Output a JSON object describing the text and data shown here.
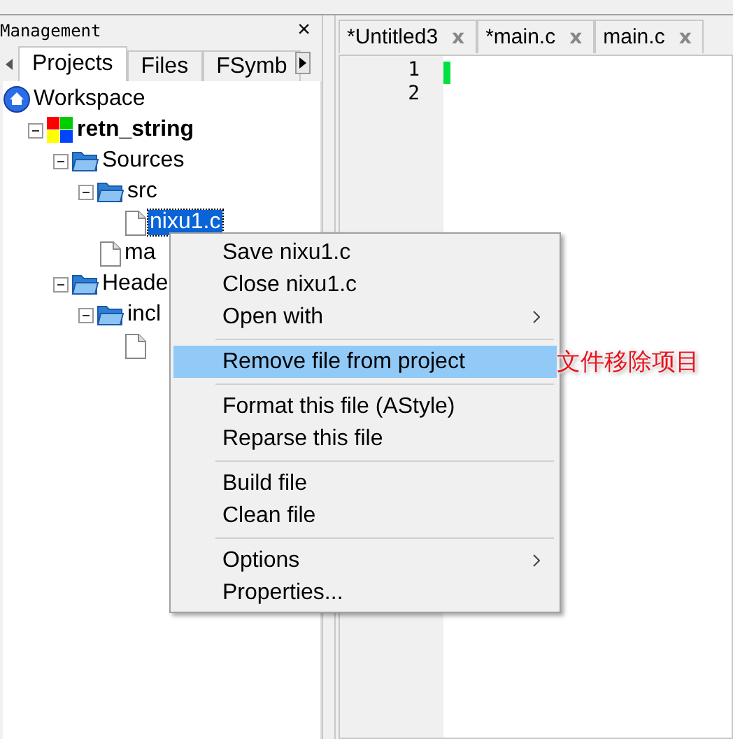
{
  "panel": {
    "title": "Management",
    "close": "×"
  },
  "panel_tabs": [
    {
      "label": "Projects",
      "selected": true
    },
    {
      "label": "Files",
      "selected": false
    },
    {
      "label": "FSymb",
      "selected": false
    }
  ],
  "tree": [
    {
      "label": "Workspace",
      "kind": "workspace",
      "children": [
        {
          "label": "retn_string",
          "kind": "project",
          "expanded": true,
          "children": [
            {
              "label": "Sources",
              "kind": "folder",
              "expanded": true,
              "children": [
                {
                  "label": "src",
                  "kind": "folder",
                  "expanded": true,
                  "children": [
                    {
                      "label": "nixu1.c",
                      "kind": "file",
                      "selected": true
                    }
                  ]
                },
                {
                  "label": "ma",
                  "kind": "file",
                  "selected": false
                }
              ]
            },
            {
              "label": "Heade",
              "kind": "folder",
              "expanded": true,
              "children": [
                {
                  "label": "incl",
                  "kind": "folder",
                  "expanded": true,
                  "children": [
                    {
                      "kind": "file"
                    }
                  ]
                }
              ]
            }
          ]
        }
      ]
    }
  ],
  "editor_tabs": [
    {
      "label": "*Untitled3",
      "close": "x"
    },
    {
      "label": "*main.c",
      "close": "x"
    },
    {
      "label": "main.c",
      "close": "x"
    }
  ],
  "line_numbers": [
    "1",
    "2"
  ],
  "context_menu": [
    {
      "kind": "item",
      "label": "Save nixu1.c",
      "selected": false
    },
    {
      "kind": "item",
      "label": "Close nixu1.c",
      "selected": false
    },
    {
      "kind": "item",
      "label": "Open with",
      "submenu": true,
      "selected": false
    },
    {
      "kind": "separator"
    },
    {
      "kind": "item",
      "label": "Remove file from project",
      "selected": true
    },
    {
      "kind": "separator"
    },
    {
      "kind": "item",
      "label": "Format this file (AStyle)",
      "selected": false
    },
    {
      "kind": "item",
      "label": "Reparse this file",
      "selected": false
    },
    {
      "kind": "separator"
    },
    {
      "kind": "item",
      "label": "Build file",
      "selected": false
    },
    {
      "kind": "item",
      "label": "Clean file",
      "selected": false
    },
    {
      "kind": "separator"
    },
    {
      "kind": "item",
      "label": "Options",
      "submenu": true,
      "selected": false
    },
    {
      "kind": "item",
      "label": "Properties...",
      "selected": false
    }
  ],
  "annotation": "文件移除项目"
}
